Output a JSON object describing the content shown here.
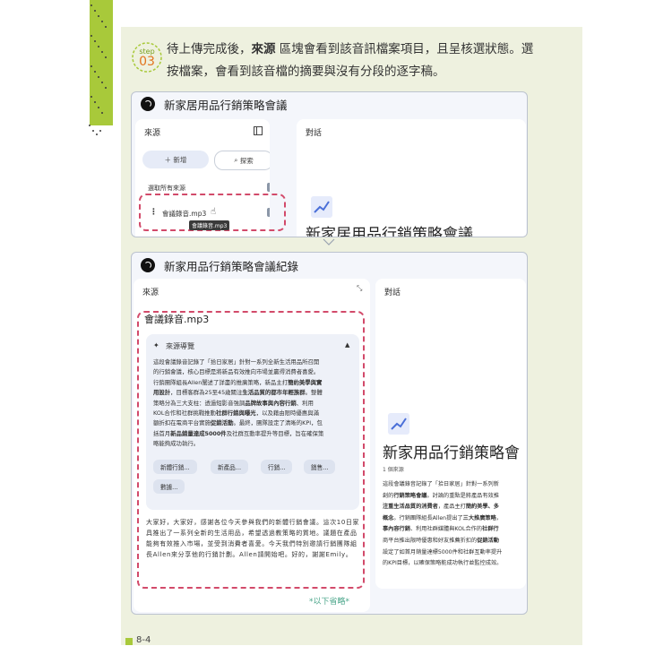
{
  "step": {
    "label": "step",
    "number": "03",
    "text_segments": [
      "待上傳完成後，",
      "來源",
      " 區塊會看到該音訊檔案項目，且呈核選狀態。選按檔案，會看到該音檔的摘要與沒有分段的逐字稿。"
    ]
  },
  "card1": {
    "title": "新家居用品行銷策略會議",
    "sources_header": "來源",
    "add_button": "＋ 新增",
    "search_button": "探索",
    "select_all_label": "選取所有來源",
    "file_name": "會議錄音.mp3",
    "tooltip": "會議錄音.mp3",
    "chat_header": "對話",
    "notebook_title": "新家居用品行銷策略會議"
  },
  "card2": {
    "title": "新家用品行銷策略會議紀錄",
    "sources_header": "來源",
    "chat_header": "對話",
    "file_title": "會議錄音.mp3",
    "guide_header": "來源導覽",
    "summary_lines": [
      [
        {
          "t": "這段會議錄音記錄了「拾日家居」針對一系列全新生活用品所召開"
        }
      ],
      [
        {
          "t": "的行銷會議，核心目標是將新品有效推向市場並贏得消費者喜愛。"
        }
      ],
      [
        {
          "t": "行銷團隊組長Allen闡述了詳盡的推廣策略，新品主打"
        },
        {
          "t": "簡約美學與實",
          "b": true
        }
      ],
      [
        {
          "t": "用設計",
          "b": true
        },
        {
          "t": "，目標客群為25至45歲關注"
        },
        {
          "t": "生活品質的都市年輕族群",
          "b": true
        },
        {
          "t": "。整體"
        }
      ],
      [
        {
          "t": "策略分為三大支柱：透過短影音強調"
        },
        {
          "t": "品牌故事與內容行銷",
          "b": true
        },
        {
          "t": "、利用"
        }
      ],
      [
        {
          "t": "KOL合作和社群挑戰推動"
        },
        {
          "t": "社群行銷與曝光",
          "b": true
        },
        {
          "t": "，以及藉由限時優惠與滿"
        }
      ],
      [
        {
          "t": "額折扣在電商平台實施"
        },
        {
          "t": "促銷活動",
          "b": true
        },
        {
          "t": "。最終，團隊設定了清晰的KPI，包"
        }
      ],
      [
        {
          "t": "括首月"
        },
        {
          "t": "新品銷量達成5000件",
          "b": true
        },
        {
          "t": "及社群互動率提升等目標，旨在確保策"
        }
      ],
      [
        {
          "t": "略能夠成功執行。"
        }
      ]
    ],
    "topic_chips": [
      "新體行銷...",
      "新產品...",
      "行銷...",
      "銷售...",
      "數據..."
    ],
    "transcript": "大家好，大家好，感謝各位今天參與我們的新體行銷會議。這次10日家具推出了一系列全新的生活用品，希望透過教策略的質地。議題在產品能夠有效推入市場，並受到消費者喜愛。今天我們特別邀請行銷團隊組長Allen來分享他的行銷計劃。Allen請開始吧。好的，謝謝Emily。",
    "notebook_title": "新家用品行銷策略會",
    "source_count": "1 個來源",
    "right_lines": [
      [
        {
          "t": "這段會議錄音記錄了「拾日家居」針對一系列新"
        }
      ],
      [
        {
          "t": "創的"
        },
        {
          "t": "行銷策略會議",
          "b": true
        },
        {
          "t": "。討論的重點是將產品有效推"
        }
      ],
      [
        {
          "t": "注重生活品質的消費者",
          "b": true
        },
        {
          "t": "，產品主打"
        },
        {
          "t": "簡約美學、多",
          "b": true
        }
      ],
      [
        {
          "t": "概念",
          "b": true
        },
        {
          "t": "。行銷團隊組長Allen提出了"
        },
        {
          "t": "三大推廣策略",
          "b": true
        },
        {
          "t": "，"
        }
      ],
      [
        {
          "t": "事內容行銷",
          "b": true
        },
        {
          "t": "、利用社群媒體與KOL合作的"
        },
        {
          "t": "社群行",
          "b": true
        }
      ],
      [
        {
          "t": "商平台推出限時優惠和好友推薦折扣的"
        },
        {
          "t": "促銷活動",
          "b": true
        }
      ],
      [
        {
          "t": "設定了如首月銷量達標5000件和社群互動率提升"
        }
      ],
      [
        {
          "t": "的KPI目標，以確保策略能成功執行並監控成效。"
        }
      ]
    ],
    "omitted_note": "*以下省略*"
  },
  "footer": {
    "page_number": "8-4"
  },
  "colors": {
    "accent_green": "#a8c93a",
    "dash_red": "#d24a6a",
    "panel_bg": "#eef1df"
  },
  "icons": [
    "notebook-logo-icon",
    "panel-toggle-icon",
    "search-sparkle-icon",
    "more-vert-icon",
    "cursor-hand-icon",
    "chart-icon",
    "sparkle-icon",
    "collapse-caret-icon",
    "expand-arrows-icon"
  ]
}
